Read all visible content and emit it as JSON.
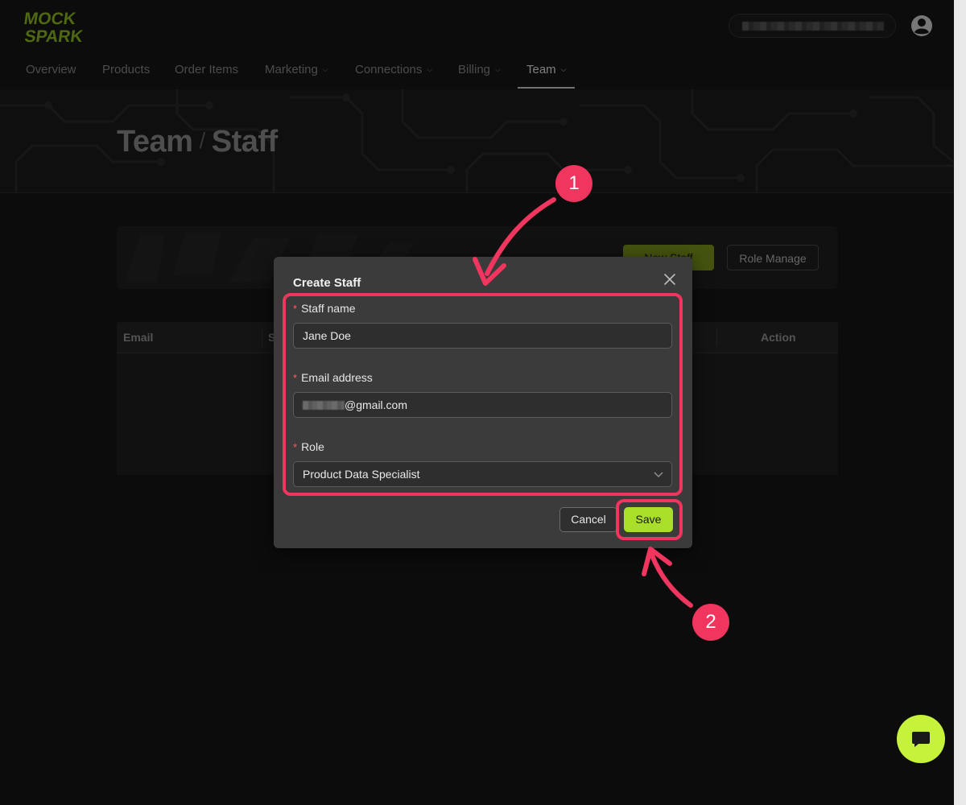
{
  "brand": {
    "logo_top": "MOCK",
    "logo_bottom": "SPARK",
    "accent_color": "#a9df28"
  },
  "header": {
    "search_value_redacted": true,
    "user_icon": "user-circle-icon"
  },
  "nav": {
    "items": [
      {
        "label": "Overview",
        "has_dropdown": false
      },
      {
        "label": "Products",
        "has_dropdown": false
      },
      {
        "label": "Order Items",
        "has_dropdown": false
      },
      {
        "label": "Marketing",
        "has_dropdown": true
      },
      {
        "label": "Connections",
        "has_dropdown": true
      },
      {
        "label": "Billing",
        "has_dropdown": true
      },
      {
        "label": "Team",
        "has_dropdown": true,
        "active": true
      }
    ]
  },
  "hero": {
    "breadcrumb_parent": "Team",
    "separator": "/",
    "breadcrumb_current": "Staff"
  },
  "toolbar": {
    "new_staff_label": "New Staff",
    "role_manage_label": "Role Manage"
  },
  "table": {
    "columns": [
      "Email",
      "S",
      "Action"
    ]
  },
  "modal": {
    "title": "Create Staff",
    "fields": {
      "staff_name": {
        "label": "Staff name",
        "required": true,
        "value": "Jane Doe"
      },
      "email": {
        "label": "Email address",
        "required": true,
        "value_suffix": "@gmail.com",
        "value_prefix_redacted": true
      },
      "role": {
        "label": "Role",
        "required": true,
        "value": "Product Data Specialist"
      }
    },
    "cancel_label": "Cancel",
    "save_label": "Save"
  },
  "annotations": {
    "step1": "1",
    "step2": "2",
    "highlight_color": "#f0355e"
  },
  "chat": {
    "icon": "chat-bubble-icon"
  }
}
